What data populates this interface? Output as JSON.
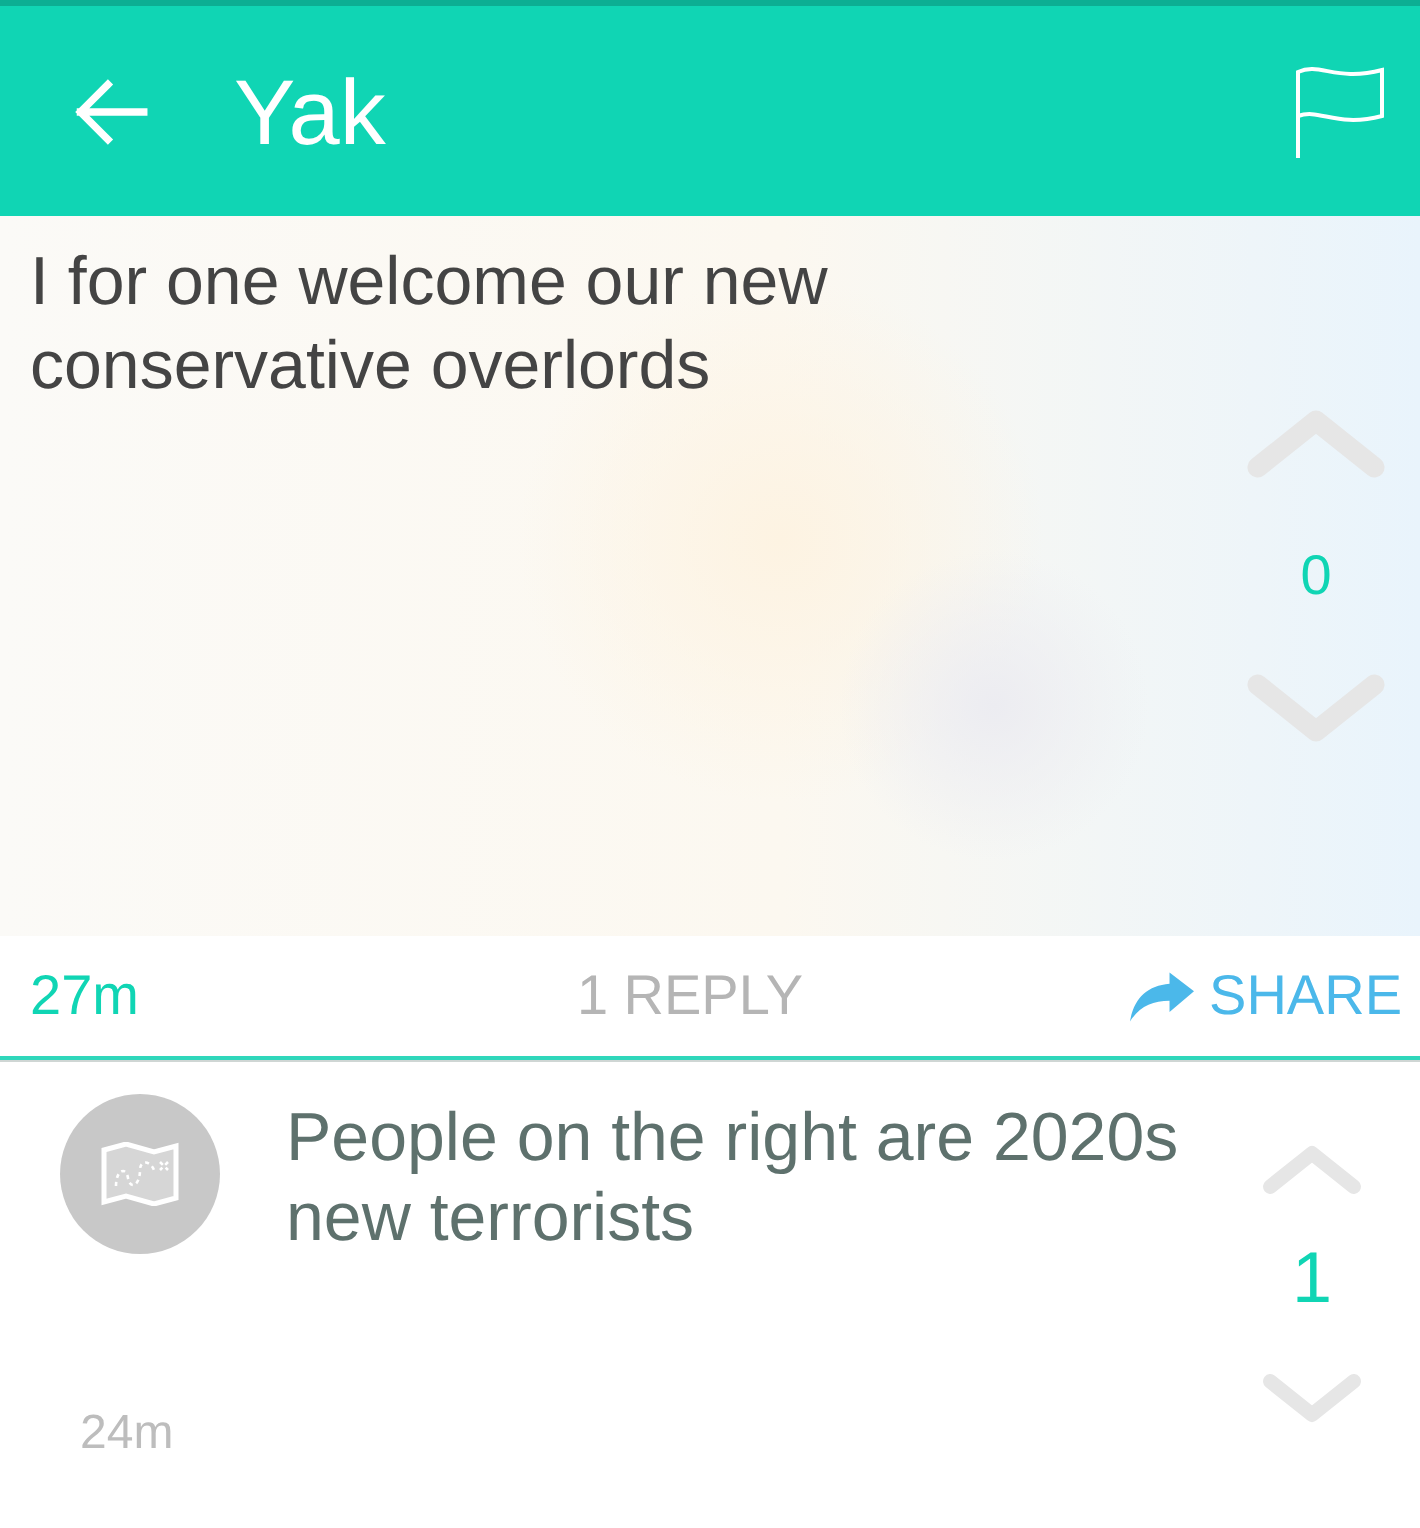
{
  "header": {
    "title": "Yak"
  },
  "post": {
    "text": "I for one welcome our new conservative overlords",
    "score": "0",
    "time": "27m",
    "replies": "1 REPLY",
    "share": "SHARE"
  },
  "replies": [
    {
      "text": "People on the right are 2020s new terrorists",
      "score": "1",
      "time": "24m"
    }
  ]
}
